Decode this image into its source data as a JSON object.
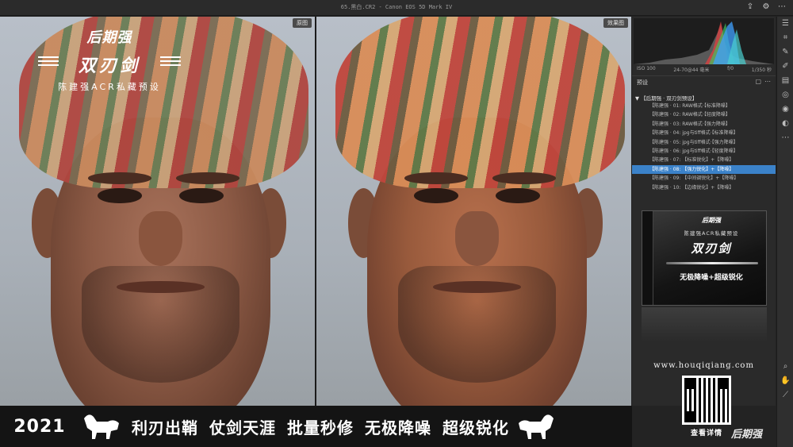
{
  "window": {
    "title": "65.黑白.CR2 - Canon EOS 5D Mark IV"
  },
  "panes": {
    "before_label": "原图",
    "after_label": "效果图"
  },
  "overlay_logo": {
    "brand": "后期强",
    "title": "双刃剑",
    "subtitle": "陈建强ACR私藏预设"
  },
  "exif": {
    "iso": "ISO 100",
    "focal": "24-70@44 毫米",
    "aperture": "f/0",
    "shutter": "1/350 秒"
  },
  "presets_panel": {
    "title": "预设",
    "group": "▼ 【后期强 · 双刃剑预设】",
    "items": [
      {
        "label": "【陈建强 · 01: RAW格式·【标准降噪】"
      },
      {
        "label": "【陈建强 · 02: RAW格式·【轻度降噪】"
      },
      {
        "label": "【陈建强 · 03: RAW格式·【强力降噪】"
      },
      {
        "label": "【陈建强 · 04: jpg与tiff格式·【标准降噪】"
      },
      {
        "label": "【陈建强 · 05: jpg与tiff格式·【强力降噪】"
      },
      {
        "label": "【陈建强 · 06: jpg与tiff格式·【轻度降噪】"
      },
      {
        "label": "【陈建强 · 07: 【标准锐化】+【降噪】"
      },
      {
        "label": "【陈建强 · 08: 【强力锐化】+【降噪】"
      },
      {
        "label": "【陈建强 · 09: 【中间调锐化】+【降噪】"
      },
      {
        "label": "【陈建强 · 10: 【边缘锐化】+【降噪】"
      }
    ],
    "active_index": 7
  },
  "product": {
    "brand": "后期强",
    "sub": "陈建强ACR私藏预设",
    "title": "双刃剑",
    "tagline": "无极降噪+超级锐化"
  },
  "website": "www.houqiqiang.com",
  "qr_caption": "查看详情",
  "corner_brand": "后期强",
  "banner": {
    "year": "2021",
    "slogans": [
      "利刃出鞘",
      "仗剑天涯",
      "批量秒修",
      "无极降噪",
      "超级锐化"
    ]
  },
  "colors": {
    "accent": "#3b82c9",
    "panel_bg": "#2a2a2a",
    "banner_bg": "#141414"
  },
  "icons": {
    "topbar": [
      "export-icon",
      "gear-icon",
      "more-icon"
    ],
    "toolstrip": [
      "edit-sliders-icon",
      "crop-icon",
      "healing-icon",
      "brush-icon",
      "gradient-icon",
      "radial-icon",
      "redeye-icon",
      "presets-icon",
      "more-icon",
      "zoom-icon",
      "hand-icon",
      "eyedropper-icon"
    ]
  }
}
